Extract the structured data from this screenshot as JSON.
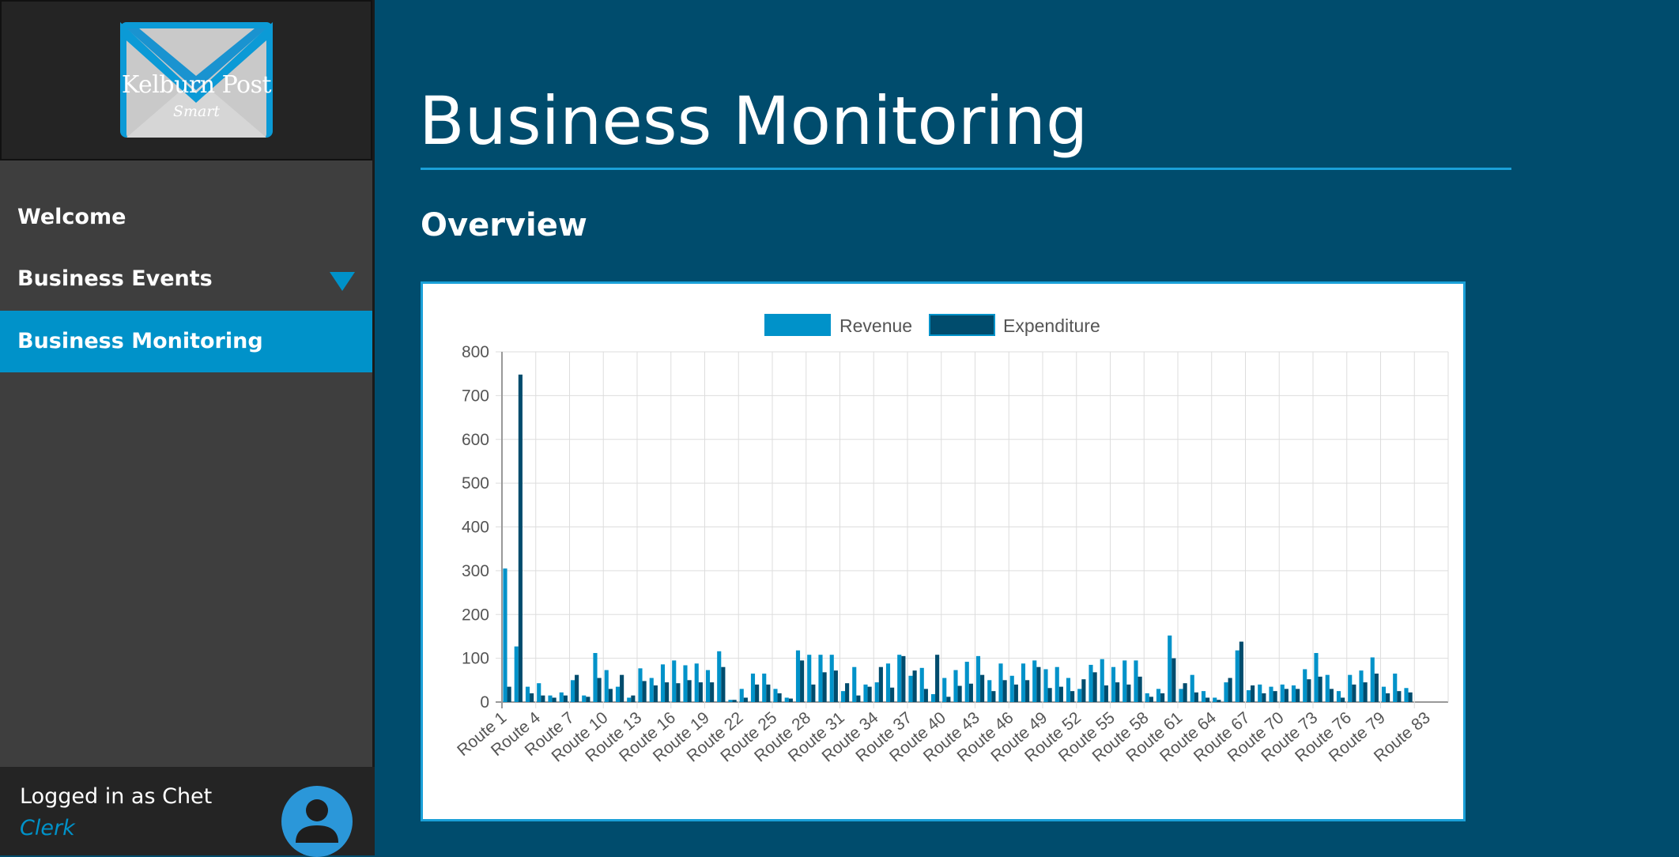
{
  "sidebar": {
    "logo": {
      "text": "Kelburn Post",
      "subtext": "Smart"
    },
    "items": [
      {
        "label": "Welcome"
      },
      {
        "label": "Business Events"
      },
      {
        "label": "Business Monitoring"
      }
    ],
    "footer": {
      "user": "Logged in as Chet",
      "role": "Clerk"
    }
  },
  "main": {
    "title": "Business Monitoring",
    "section": "Overview"
  },
  "colors": {
    "accent": "#0092c9",
    "background": "#004c6d",
    "revenue": "#0092c9",
    "expenditure": "#004c6d"
  },
  "chart_data": {
    "type": "bar",
    "legend": [
      "Revenue",
      "Expenditure"
    ],
    "legend_position": "top",
    "ylim": [
      0,
      800
    ],
    "yticks": [
      0,
      100,
      200,
      300,
      400,
      500,
      600,
      700,
      800
    ],
    "grid": true,
    "x_tick_labels": [
      "Route 1",
      "Route 4",
      "Route 7",
      "Route 10",
      "Route 13",
      "Route 16",
      "Route 19",
      "Route 22",
      "Route 25",
      "Route 28",
      "Route 31",
      "Route 34",
      "Route 37",
      "Route 40",
      "Route 43",
      "Route 46",
      "Route 49",
      "Route 52",
      "Route 55",
      "Route 58",
      "Route 61",
      "Route 64",
      "Route 67",
      "Route 70",
      "Route 73",
      "Route 76",
      "Route 79",
      "Route 83"
    ],
    "categories_count": 84,
    "series": [
      {
        "name": "Revenue",
        "values": [
          305,
          127,
          35,
          43,
          15,
          22,
          50,
          15,
          112,
          73,
          35,
          10,
          77,
          55,
          86,
          95,
          84,
          88,
          73,
          116,
          5,
          30,
          65,
          65,
          30,
          10,
          118,
          108,
          108,
          108,
          25,
          80,
          40,
          45,
          88,
          108,
          60,
          78,
          18,
          55,
          73,
          92,
          105,
          50,
          88,
          60,
          88,
          95,
          75,
          80,
          55,
          30,
          85,
          98,
          80,
          95,
          95,
          20,
          30,
          152,
          30,
          62,
          25,
          10,
          45,
          118,
          27,
          40,
          35,
          40,
          38,
          75,
          112,
          62,
          25,
          62,
          72,
          102,
          35,
          65,
          32,
          0,
          0,
          0
        ]
      },
      {
        "name": "Expenditure",
        "values": [
          35,
          748,
          20,
          15,
          10,
          15,
          62,
          12,
          55,
          30,
          62,
          15,
          48,
          38,
          45,
          43,
          50,
          45,
          45,
          80,
          5,
          10,
          40,
          40,
          20,
          8,
          95,
          40,
          68,
          72,
          43,
          15,
          35,
          80,
          33,
          105,
          72,
          30,
          108,
          12,
          37,
          42,
          62,
          25,
          50,
          40,
          50,
          80,
          32,
          35,
          25,
          52,
          68,
          38,
          45,
          40,
          58,
          12,
          20,
          100,
          43,
          22,
          10,
          5,
          55,
          138,
          38,
          20,
          25,
          30,
          30,
          52,
          58,
          30,
          10,
          40,
          45,
          65,
          20,
          25,
          22,
          0,
          0,
          0
        ]
      }
    ]
  }
}
